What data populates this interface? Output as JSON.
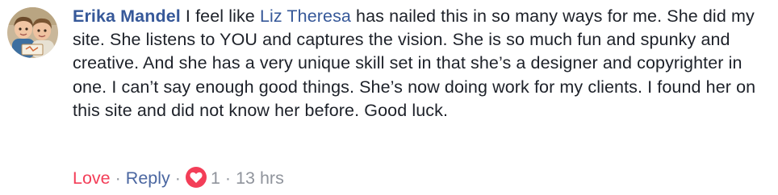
{
  "comment": {
    "author": "Erika Mandel",
    "text_before_mention": " I feel like ",
    "mention": "Liz Theresa",
    "text_after_mention": " has nailed this in so many ways for me. She did my site. She listens to YOU and captures the vision. She is so much fun and spunky and creative. And she has a very unique skill set in that she’s a designer and copyrighter in one. I can’t say enough good things. She’s now doing work for my clients. I found her on this site and did not know her before. Good luck."
  },
  "actions": {
    "love_label": "Love",
    "separator": "·",
    "reply_label": "Reply",
    "reaction_icon": "heart-icon",
    "reaction_count": "1",
    "timestamp": "13 hrs"
  },
  "colors": {
    "author_link": "#365899",
    "love": "#f33e58",
    "reply": "#4b67a1",
    "meta_grey": "#90949c",
    "text": "#1d2129"
  }
}
